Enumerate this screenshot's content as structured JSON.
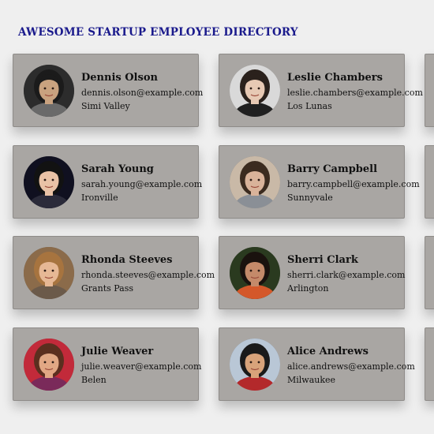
{
  "header": {
    "title": "Awesome Startup Employee Directory"
  },
  "employees": [
    {
      "name": "Dennis Olson",
      "email": "dennis.olson@example.com",
      "city": "Simi Valley"
    },
    {
      "name": "Leslie Chambers",
      "email": "leslie.chambers@example.com",
      "city": "Los Lunas"
    },
    {
      "name": "Sarah Young",
      "email": "sarah.young@example.com",
      "city": "Ironville"
    },
    {
      "name": "Barry Campbell",
      "email": "barry.campbell@example.com",
      "city": "Sunnyvale"
    },
    {
      "name": "Rhonda Steeves",
      "email": "rhonda.steeves@example.com",
      "city": "Grants Pass"
    },
    {
      "name": "Sherri Clark",
      "email": "sherri.clark@example.com",
      "city": "Arlington"
    },
    {
      "name": "Julie Weaver",
      "email": "julie.weaver@example.com",
      "city": "Belen"
    },
    {
      "name": "Alice Andrews",
      "email": "alice.andrews@example.com",
      "city": "Milwaukee"
    }
  ],
  "avatar_colors": {
    "background": [
      "#2c2c2c",
      "#d9d9d9",
      "#101020",
      "#c9b9a7",
      "#8b6b4a",
      "#2a3a1f",
      "#c22a3a",
      "#b9c7d6"
    ],
    "skin": [
      "#c9a27f",
      "#e7c9b4",
      "#e9c2a6",
      "#d9b39a",
      "#e6b895",
      "#c48a6a",
      "#e1a784",
      "#d8a37a"
    ],
    "hair": [
      "#1b1b1b",
      "#2a211c",
      "#121212",
      "#3b2b1f",
      "#a7743f",
      "#1a120e",
      "#5b2f1f",
      "#1a1a1a"
    ],
    "shirt": [
      "#6a6a6a",
      "#202020",
      "#2b2b3a",
      "#8a8f96",
      "#6b5a4a",
      "#d4582a",
      "#7a2a5a",
      "#b3292b"
    ]
  }
}
